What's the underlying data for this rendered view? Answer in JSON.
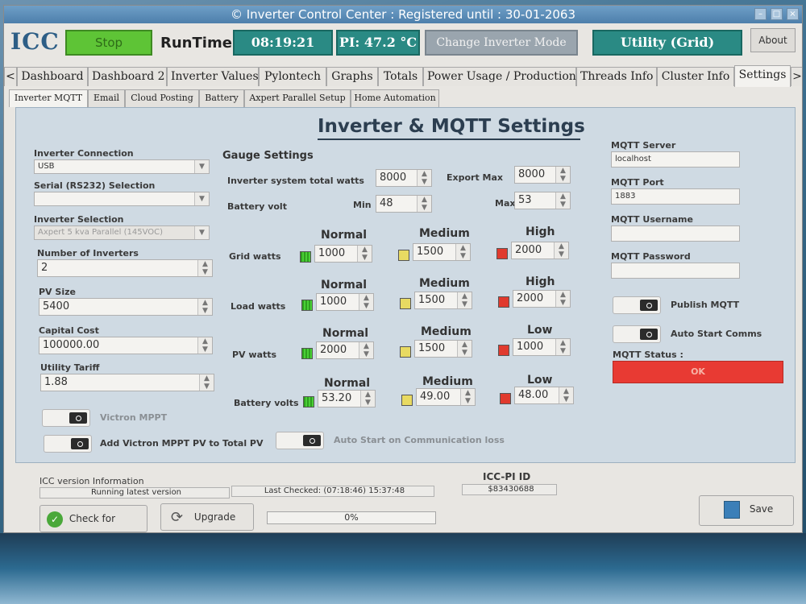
{
  "window": {
    "title": "© Inverter Control Center : Registered until : 30-01-2063",
    "controls": [
      "–",
      "□",
      "×"
    ]
  },
  "topbar": {
    "logo": "ICC",
    "logo_sub": "",
    "stop_label": "Stop",
    "runtime_label": "RunTime",
    "clock": "08:19:21",
    "pi_temp": "PI: 47.2 °C",
    "change_mode_label": "Change Inverter Mode",
    "mode": "Utility (Grid)",
    "about_label": "About"
  },
  "main_tabs": [
    {
      "label": "Dashboard"
    },
    {
      "label": "Dashboard 2"
    },
    {
      "label": "Inverter Values"
    },
    {
      "label": "Pylontech"
    },
    {
      "label": "Graphs"
    },
    {
      "label": "Totals"
    },
    {
      "label": "Power Usage / Production"
    },
    {
      "label": "Threads Info"
    },
    {
      "label": "Cluster Info"
    },
    {
      "label": "Settings"
    }
  ],
  "nav": {
    "left": "<",
    "right": ">"
  },
  "sub_tabs": [
    {
      "label": "Inverter MQTT"
    },
    {
      "label": "Email"
    },
    {
      "label": "Cloud Posting"
    },
    {
      "label": "Battery"
    },
    {
      "label": "Axpert Parallel Setup"
    },
    {
      "label": "Home Automation"
    }
  ],
  "panel": {
    "title": "Inverter & MQTT Settings"
  },
  "left": {
    "inverter_connection_label": "Inverter Connection",
    "inverter_connection_value": "USB",
    "serial_label": "Serial (RS232)  Selection",
    "serial_value": "",
    "inverter_selection_label": "Inverter Selection",
    "inverter_selection_value": "Axpert 5 kva Parallel (145VOC)",
    "num_inverters_label": "Number of Inverters",
    "num_inverters_value": "2",
    "pv_size_label": "PV Size",
    "pv_size_value": "5400",
    "capital_cost_label": "Capital  Cost",
    "capital_cost_value": "100000.00",
    "utility_tariff_label": "Utility Tariff",
    "utility_tariff_value": "1.88",
    "victron_mppt_label": "Victron MPPT",
    "add_victron_label": "Add Victron MPPT PV to Total PV",
    "auto_start_comm_label": "Auto Start on Communication loss"
  },
  "gauge": {
    "heading": "Gauge Settings",
    "inverter_total_watts_label": "Inverter system total watts",
    "inverter_total_watts_value": "8000",
    "export_max_label": "Export Max",
    "export_max_value": "8000",
    "battery_volt_label": "Battery volt",
    "min_label": "Min",
    "min_value": "48",
    "max_label": "Max",
    "max_value": "53",
    "rows": [
      {
        "label": "Grid watts",
        "h1": "Normal",
        "v1": "1000",
        "h2": "Medium",
        "v2": "1500",
        "h3": "High",
        "v3": "2000"
      },
      {
        "label": "Load watts",
        "h1": "Normal",
        "v1": "1000",
        "h2": "Medium",
        "v2": "1500",
        "h3": "High",
        "v3": "2000"
      },
      {
        "label": "PV watts",
        "h1": "Normal",
        "v1": "2000",
        "h2": "Medium",
        "v2": "1500",
        "h3": "Low",
        "v3": "1000"
      },
      {
        "label": "Battery volts",
        "h1": "Normal",
        "v1": "53.20",
        "h2": "Medium",
        "v2": "49.00",
        "h3": "Low",
        "v3": "48.00"
      }
    ]
  },
  "mqtt": {
    "server_label": "MQTT Server",
    "server_value": "localhost",
    "port_label": "MQTT Port",
    "port_value": "1883",
    "username_label": "MQTT Username",
    "username_value": "",
    "password_label": "MQTT Password",
    "password_value": "",
    "publish_label": "Publish MQTT",
    "auto_start_label": "Auto Start Comms",
    "status_label": "MQTT Status :",
    "status_value": "OK"
  },
  "bottom": {
    "version_label": "ICC version Information",
    "version_status": "Running latest version",
    "last_checked": "Last Checked: (07:18:46)  15:37:48",
    "pi_id_label": "ICC-PI ID",
    "pi_id_value": "$83430688",
    "check_update_label": "Check for update",
    "upgrade_label": "Upgrade",
    "progress_text": "0%",
    "progress_value": 0,
    "save_label": "Save"
  },
  "colors": {
    "stop": "#5ec436",
    "teal": "#2a8a84",
    "status_ok": "#e83a33"
  }
}
